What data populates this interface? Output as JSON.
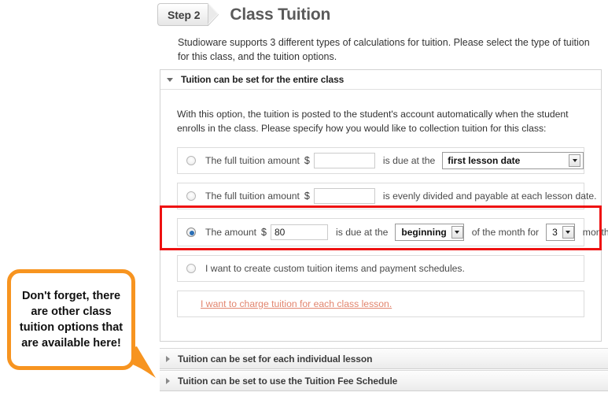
{
  "header": {
    "step_label": "Step 2",
    "title": "Class Tuition"
  },
  "intro": "Studioware supports 3 different types of calculations for tuition. Please select the type of tuition for this class, and the tuition options.",
  "panel": {
    "header_label": "Tuition can be set for the entire class",
    "description": "With this option, the tuition is posted to the student's account automatically when the student enrolls in the class. Please specify how you would like to collection tuition for this class:",
    "options": [
      {
        "id": "full-tuition-due-at",
        "selected": false,
        "label_before": "The full tuition amount",
        "currency": "$",
        "amount_value": "",
        "label_middle": "is due at the",
        "select_value": "first lesson date"
      },
      {
        "id": "full-tuition-divided",
        "selected": false,
        "label_before": "The full tuition amount",
        "currency": "$",
        "amount_value": "",
        "label_after": "is evenly divided and payable at each lesson date."
      },
      {
        "id": "amount-monthly",
        "selected": true,
        "label_before": "The amount",
        "currency": "$",
        "amount_value": "80",
        "label_middle": "is due at the",
        "period_select_value": "beginning",
        "label_middle2": "of the month for",
        "months_select_value": "3",
        "label_after": "month(s)"
      },
      {
        "id": "custom-tuition",
        "selected": false,
        "label": "I want to create custom tuition items and payment schedules."
      }
    ],
    "link_row_text": "I want to charge tuition for each class lesson."
  },
  "accordions": [
    {
      "label": "Tuition can be set for each individual lesson"
    },
    {
      "label": "Tuition can be set to use the Tuition Fee Schedule"
    }
  ],
  "callout": {
    "text": "Don't forget, there are other class tuition options that are available here!"
  },
  "colors": {
    "highlight_red": "#ee1111",
    "callout_orange": "#f79420",
    "link_orange": "#e2856e",
    "radio_blue": "#2b6fb5"
  }
}
